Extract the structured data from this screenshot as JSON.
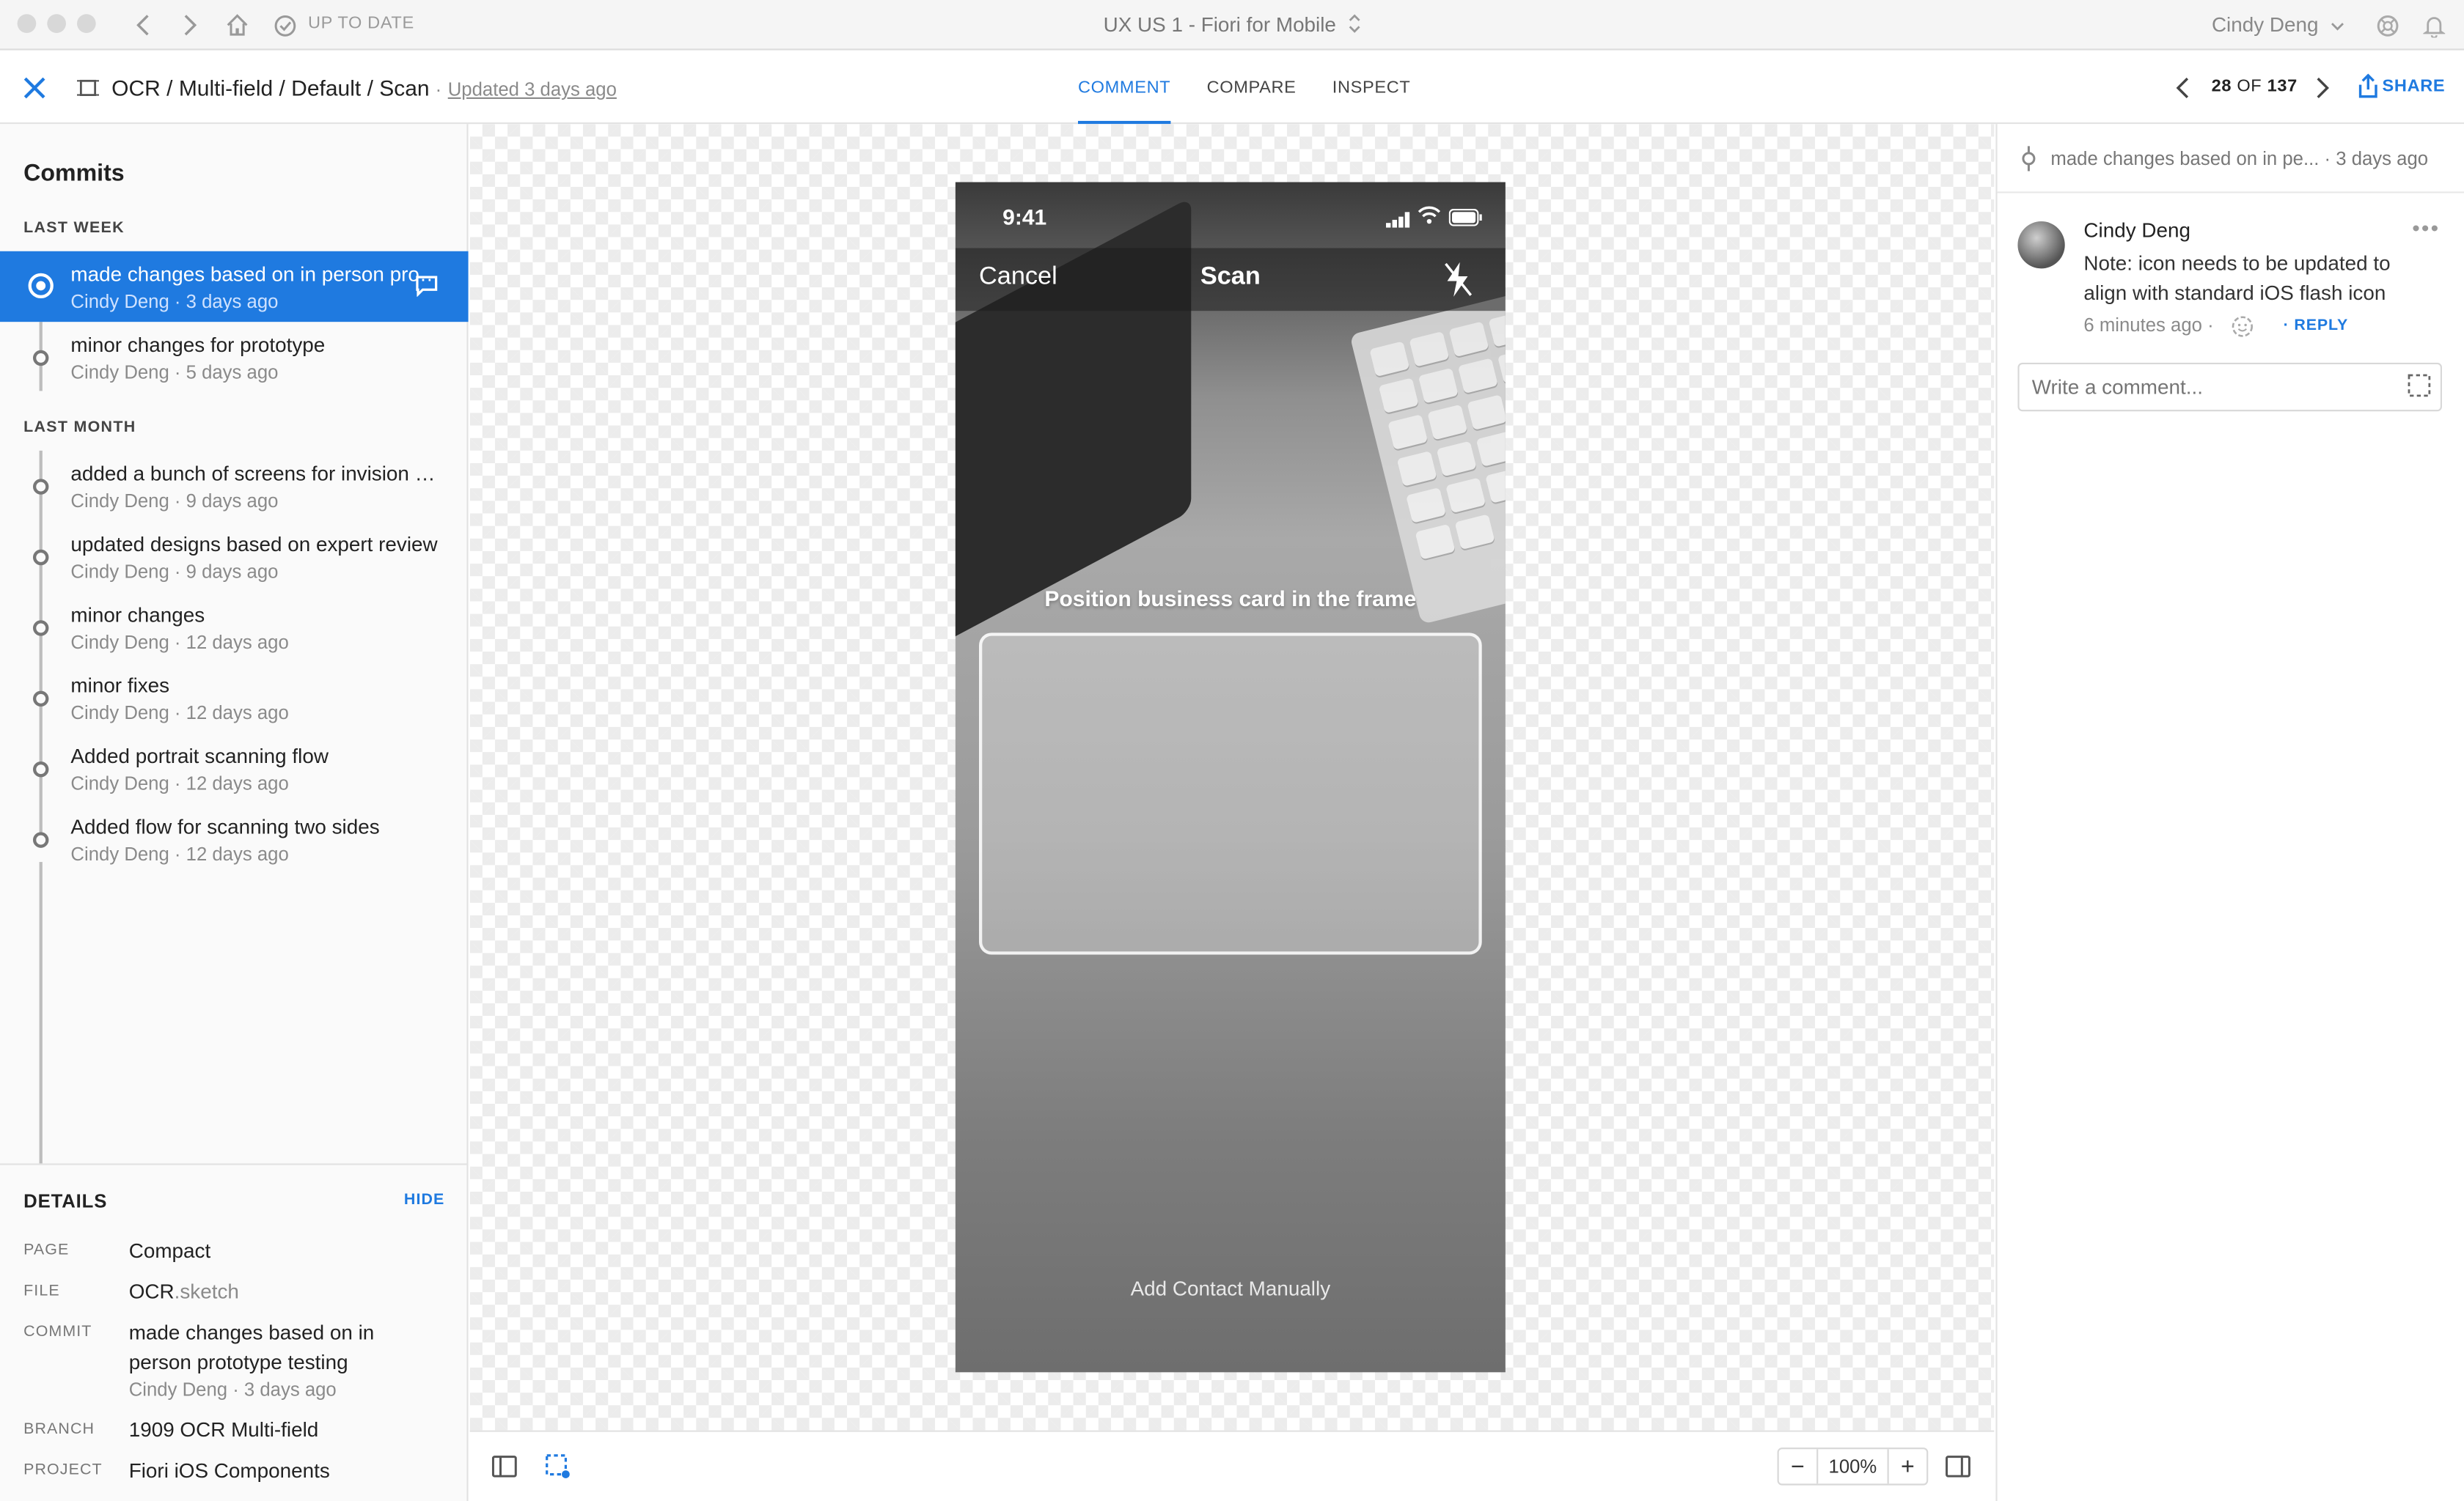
{
  "titlebar": {
    "sync_status": "UP TO DATE",
    "window_title": "UX US 1 - Fiori for Mobile",
    "user": "Cindy Deng"
  },
  "header": {
    "breadcrumb": "OCR / Multi-field / Default / Scan",
    "updated": "Updated 3 days ago",
    "tabs": [
      "COMMENT",
      "COMPARE",
      "INSPECT"
    ],
    "active_tab": "COMMENT",
    "pager": {
      "current": "28",
      "of": "OF",
      "total": "137"
    },
    "share": "SHARE"
  },
  "commits": {
    "title": "Commits",
    "groups": [
      {
        "label": "LAST WEEK",
        "items": [
          {
            "message": "made changes based on in person prototype testing",
            "meta": "Cindy Deng · 3 days ago",
            "selected": true
          },
          {
            "message": "minor changes for prototype",
            "meta": "Cindy Deng · 5 days ago"
          }
        ]
      },
      {
        "label": "LAST MONTH",
        "items": [
          {
            "message": "added a bunch of screens for invision prototype",
            "meta": "Cindy Deng · 9 days ago"
          },
          {
            "message": "updated designs based on expert review",
            "meta": "Cindy Deng · 9 days ago"
          },
          {
            "message": "minor changes",
            "meta": "Cindy Deng · 12 days ago"
          },
          {
            "message": "minor fixes",
            "meta": "Cindy Deng · 12 days ago"
          },
          {
            "message": "Added portrait scanning flow",
            "meta": "Cindy Deng · 12 days ago"
          },
          {
            "message": "Added flow for scanning two sides",
            "meta": "Cindy Deng · 12 days ago"
          }
        ]
      }
    ]
  },
  "details": {
    "title": "DETAILS",
    "hide": "HIDE",
    "page_label": "PAGE",
    "page": "Compact",
    "file_label": "FILE",
    "file_name": "OCR",
    "file_ext": ".sketch",
    "commit_label": "COMMIT",
    "commit": "made changes based on in person prototype testing",
    "commit_meta": "Cindy Deng · 3 days ago",
    "branch_label": "BRANCH",
    "branch": "1909 OCR Multi-field",
    "project_label": "PROJECT",
    "project": "Fiori iOS Components"
  },
  "artboard": {
    "time": "9:41",
    "cancel": "Cancel",
    "title": "Scan",
    "instruction": "Position business card in the frame",
    "add_manually": "Add Contact Manually"
  },
  "zoom": {
    "value": "100%",
    "minus": "−",
    "plus": "+"
  },
  "comments_panel": {
    "header": "made changes based on in pe... · 3 days ago",
    "comment": {
      "author": "Cindy Deng",
      "text": "Note: icon needs to be updated to align with standard iOS flash icon",
      "time": "6 minutes ago ·",
      "reply": "· REPLY"
    },
    "input_placeholder": "Write a comment..."
  },
  "colors": {
    "accent": "#1f7ae0",
    "selected_bg": "#1f7ae0"
  }
}
